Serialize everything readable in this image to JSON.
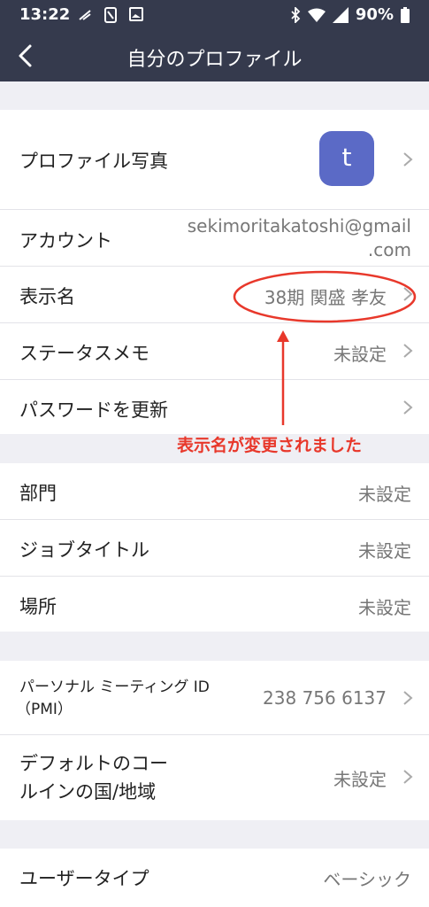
{
  "status": {
    "time": "13:22",
    "battery": "90%"
  },
  "nav": {
    "title": "自分のプロファイル"
  },
  "profile": {
    "photo_label": "プロファイル写真",
    "avatar_letter": "t",
    "account_label": "アカウント",
    "account_line1": "sekimoritakatoshi@gmail",
    "account_line2": ".com",
    "display_name_label": "表示名",
    "display_name_value": "38期  関盛 孝友",
    "status_memo_label": "ステータスメモ",
    "status_memo_value": "未設定",
    "password_label": "パスワードを更新"
  },
  "annotation": {
    "text": "表示名が変更されました",
    "color": "#e8382b"
  },
  "work": {
    "department_label": "部門",
    "department_value": "未設定",
    "job_title_label": "ジョブタイトル",
    "job_title_value": "未設定",
    "location_label": "場所",
    "location_value": "未設定"
  },
  "meeting": {
    "pmi_label_line1": "パーソナル ミーティング ID",
    "pmi_label_line2": "（PMI）",
    "pmi_value": "238 756 6137",
    "country_label_line1": "デフォルトのコー",
    "country_label_line2": "ルインの国/地域",
    "country_value": "未設定"
  },
  "user": {
    "user_type_label": "ユーザータイプ",
    "user_type_value": "ベーシック"
  }
}
